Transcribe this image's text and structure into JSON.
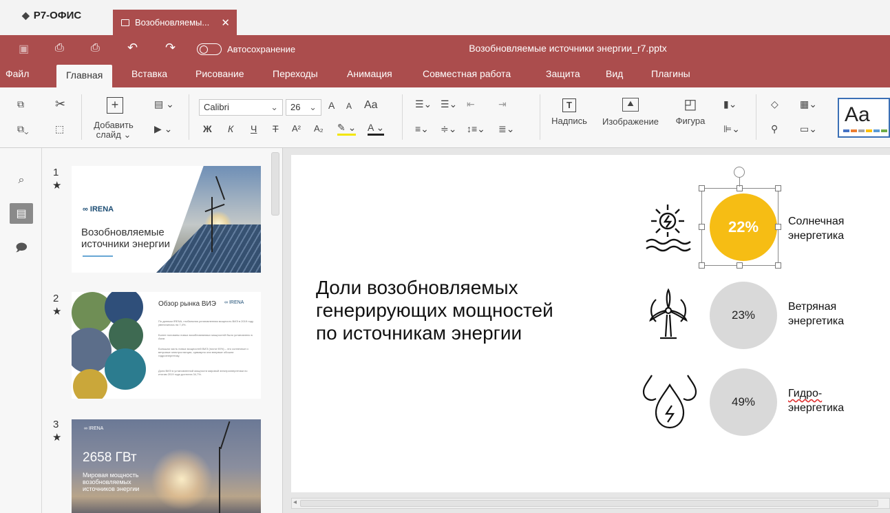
{
  "app": {
    "brand": "Р7-ОФИС",
    "doc_tab": "Возобновляемы...",
    "doc_title": "Возобновляемые источники энергии_r7.pptx",
    "autosave_label": "Автосохранение"
  },
  "menu": [
    "Файл",
    "Главная",
    "Вставка",
    "Рисование",
    "Переходы",
    "Анимация",
    "Совместная работа",
    "Защита",
    "Вид",
    "Плагины"
  ],
  "toolbar": {
    "add_slide_line1": "Добавить",
    "add_slide_line2": "слайд",
    "font_name": "Calibri",
    "font_size": "26",
    "bold": "Ж",
    "italic": "К",
    "underline": "Ч",
    "strike": "Т",
    "superscript": "A²",
    "subscript": "A₂",
    "grow": "A",
    "shrink": "A",
    "case": "Aa",
    "textbox": "Надпись",
    "image": "Изображение",
    "shape": "Фигура",
    "theme_sample": "Aa"
  },
  "slides": [
    {
      "number": "1",
      "logo": "IRENA",
      "title_l1": "Возобновляемые",
      "title_l2": "источники энергии"
    },
    {
      "number": "2",
      "title": "Обзор рынка ВИЭ",
      "logo": "IRENA",
      "bullets": [
        "По данным IRENA, глобальная установленная мощность ВИЭ в 2019 году увеличилась на 7,4%.",
        "Более половины новых возобновляемых мощностей было установлено в Азии.",
        "Большая часть новых мощностей ВИЭ (почти 90%) – это солнечные и ветровые электростанции, суммарно они впервые обошли гидроэнергетику.",
        "Доля ВИЭ в установленной мощности мировой электроэнергетики по итогам 2019 года достигла 34,7%."
      ]
    },
    {
      "number": "3",
      "logo": "IRENA",
      "big": "2658 ГВт",
      "sub": "Мировая мощность возобновляемых источников энергии"
    }
  ],
  "main_slide": {
    "heading_l1": "Доли возобновляемых",
    "heading_l2": "генерирующих мощностей",
    "heading_l3": "по источникам энергии",
    "sources": [
      {
        "value": "22%",
        "label_l1": "Солнечная",
        "label_l2": "энергетика",
        "icon": "solar-icon",
        "color": "#f6bd14"
      },
      {
        "value": "23%",
        "label_l1": "Ветряная",
        "label_l2": "энергетика",
        "icon": "wind-turbine-icon",
        "color": "#d9d9d9"
      },
      {
        "value": "49%",
        "label_l1": "Гидро-",
        "label_l2": "энергетика",
        "icon": "water-drops-icon",
        "color": "#d9d9d9"
      }
    ]
  }
}
